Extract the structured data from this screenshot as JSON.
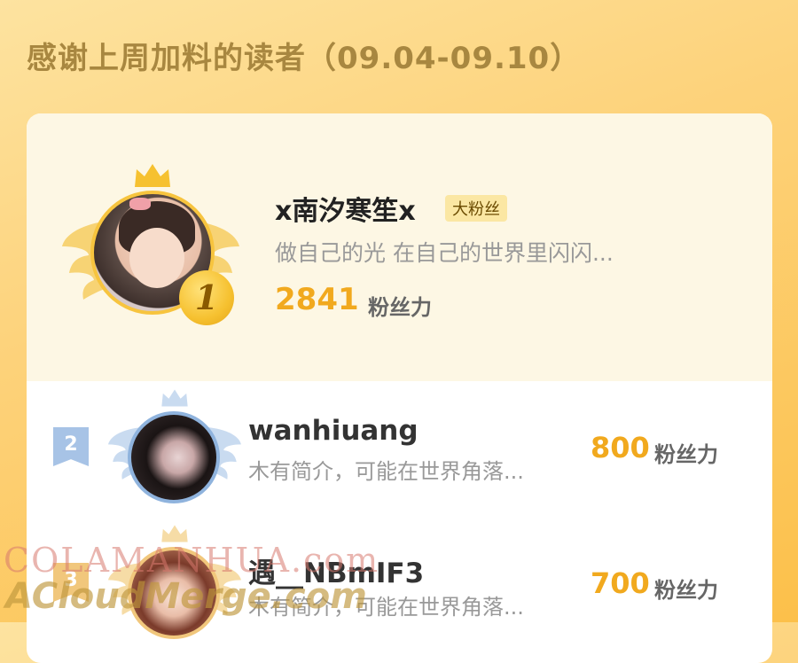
{
  "header": {
    "title": "感谢上周加料的读者（09.04-09.10）"
  },
  "leaderboard": {
    "first": {
      "rank": "1",
      "name": "x南汐寒笙x",
      "tag": "大粉丝",
      "bio": "做自己的光 在自己的世界里闪闪...",
      "score": "2841",
      "score_label": "粉丝力"
    },
    "rows": [
      {
        "rank": "2",
        "name": "wanhiuang",
        "bio": "木有简介，可能在世界角落...",
        "score": "800",
        "score_label": "粉丝力"
      },
      {
        "rank": "3",
        "name": "遇__NBmIF3",
        "bio": "木有简介，可能在世界角落...",
        "score": "700",
        "score_label": "粉丝力"
      }
    ]
  },
  "watermark": {
    "line1": "COLAMANHUA.com",
    "line2": "ACloudMerge.com"
  },
  "colors": {
    "gold": "#f1a91e",
    "silver_rank": "#a7c3e6",
    "bronze_rank": "#f1c77c",
    "background": "#fcc04a"
  }
}
